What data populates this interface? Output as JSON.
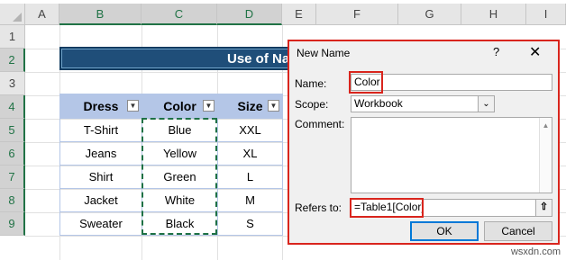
{
  "sheet": {
    "columns": [
      "A",
      "B",
      "C",
      "D",
      "E",
      "F",
      "G",
      "H",
      "I"
    ],
    "rows": [
      "1",
      "2",
      "3",
      "4",
      "5",
      "6",
      "7",
      "8",
      "9"
    ],
    "title_text": "Use of Na",
    "table_headers": [
      "Dress",
      "Color",
      "Size"
    ],
    "table_rows": [
      [
        "T-Shirt",
        "Blue",
        "XXL"
      ],
      [
        "Jeans",
        "Yellow",
        "XL"
      ],
      [
        "Shirt",
        "Green",
        "L"
      ],
      [
        "Jacket",
        "White",
        "M"
      ],
      [
        "Sweater",
        "Black",
        "S"
      ]
    ]
  },
  "dialog": {
    "title": "New Name",
    "help": "?",
    "close": "✕",
    "name_label": "Name:",
    "name_value": "Color",
    "scope_label": "Scope:",
    "scope_value": "Workbook",
    "comment_label": "Comment:",
    "refers_label": "Refers to:",
    "refers_value": "=Table1[Color]",
    "ok_label": "OK",
    "cancel_label": "Cancel"
  },
  "watermark": "wsxdn.com",
  "colors": {
    "title_fill": "#1f4e79",
    "header_fill": "#b4c6e7",
    "highlight": "#d9251d",
    "marquee": "#1e7145"
  }
}
